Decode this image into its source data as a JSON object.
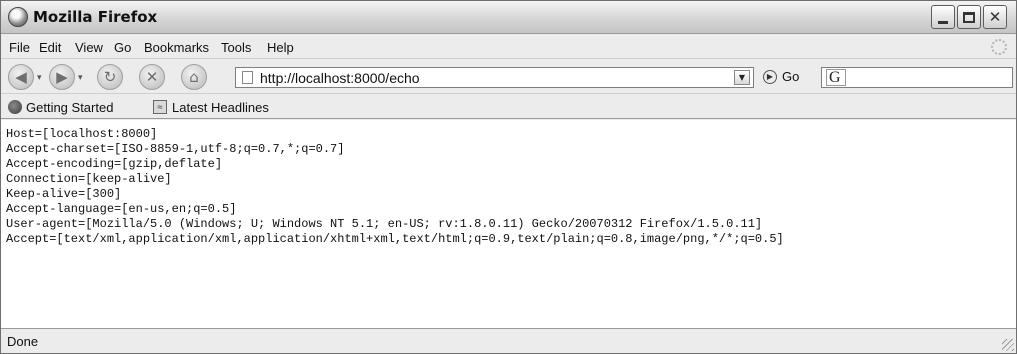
{
  "window": {
    "title": "Mozilla Firefox"
  },
  "menu": [
    "File",
    "Edit",
    "View",
    "Go",
    "Bookmarks",
    "Tools",
    "Help"
  ],
  "nav": {
    "url": "http://localhost:8000/echo",
    "go_label": "Go",
    "search_value": "",
    "icons": [
      "back-icon",
      "forward-icon",
      "reload-icon",
      "stop-icon",
      "home-icon"
    ]
  },
  "bookmarks": [
    "Getting Started",
    "Latest Headlines"
  ],
  "content": {
    "lines": [
      "Host=[localhost:8000]",
      "Accept-charset=[ISO-8859-1,utf-8;q=0.7,*;q=0.7]",
      "Accept-encoding=[gzip,deflate]",
      "Connection=[keep-alive]",
      "Keep-alive=[300]",
      "Accept-language=[en-us,en;q=0.5]",
      "User-agent=[Mozilla/5.0 (Windows; U; Windows NT 5.1; en-US; rv:1.8.0.11) Gecko/20070312 Firefox/1.5.0.11]",
      "Accept=[text/xml,application/xml,application/xhtml+xml,text/html;q=0.9,text/plain;q=0.8,image/png,*/*;q=0.5]"
    ]
  },
  "status": {
    "text": "Done"
  }
}
